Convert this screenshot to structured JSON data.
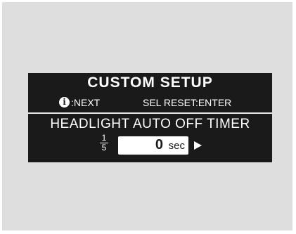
{
  "screen": {
    "title": "CUSTOM SETUP",
    "hints": {
      "info_icon_glyph": "i",
      "next_label": ":NEXT",
      "reset_label": "SEL RESET:ENTER"
    },
    "setting": {
      "name": "HEADLIGHT AUTO OFF TIMER",
      "page_current": "1",
      "page_total": "5",
      "value": "0",
      "unit": "sec",
      "next_icon": "right-triangle-icon"
    }
  },
  "colors": {
    "display_bg": "#1a1a1a",
    "display_text": "#ffffff",
    "frame_bg": "#dedede"
  }
}
